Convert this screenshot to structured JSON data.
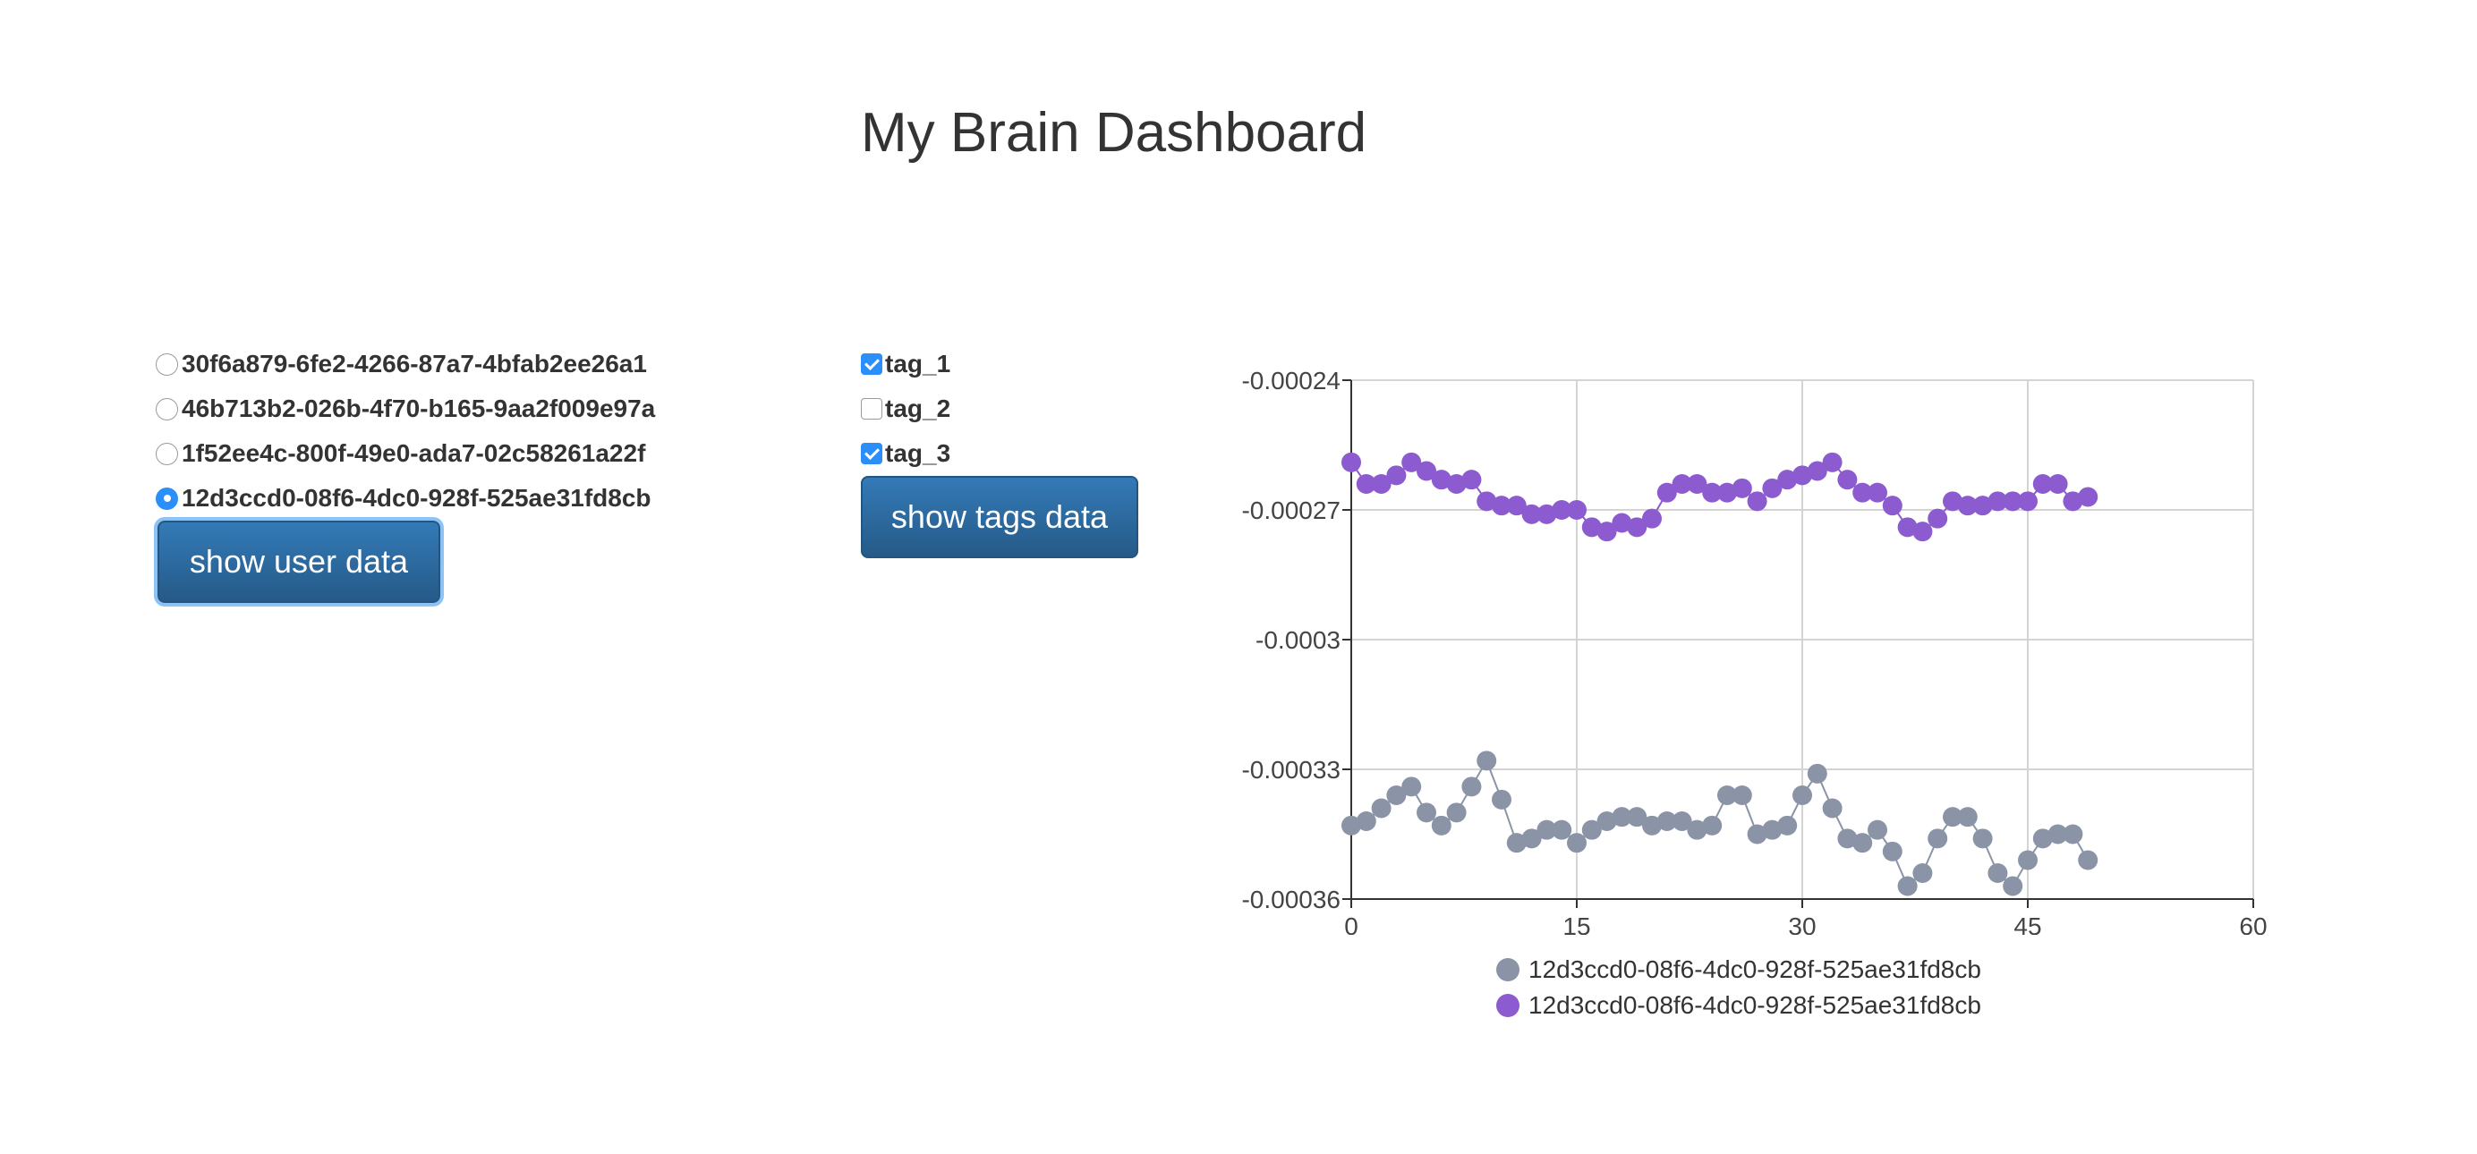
{
  "page": {
    "title": "My Brain Dashboard"
  },
  "users": {
    "options": [
      {
        "label": "30f6a879-6fe2-4266-87a7-4bfab2ee26a1",
        "checked": false
      },
      {
        "label": "46b713b2-026b-4f70-b165-9aa2f009e97a",
        "checked": false
      },
      {
        "label": "1f52ee4c-800f-49e0-ada7-02c58261a22f",
        "checked": false
      },
      {
        "label": "12d3ccd0-08f6-4dc0-928f-525ae31fd8cb",
        "checked": true
      }
    ],
    "button_label": "show user data"
  },
  "tags": {
    "options": [
      {
        "label": "tag_1",
        "checked": true
      },
      {
        "label": "tag_2",
        "checked": false
      },
      {
        "label": "tag_3",
        "checked": true
      }
    ],
    "button_label": "show tags data"
  },
  "colors": {
    "accent": "#2c8ef8",
    "button": "#2b6aa3",
    "series_gray": "#8a94a6",
    "series_purple": "#8b5bcf"
  },
  "chart_data": {
    "type": "line",
    "grid": true,
    "legend_placement": "bottom",
    "xlim": [
      0,
      60
    ],
    "ylim": [
      -0.00036,
      -0.00024
    ],
    "x_ticks": [
      0,
      15,
      30,
      45,
      60
    ],
    "x_tick_labels": [
      "0",
      "15",
      "30",
      "45",
      "60"
    ],
    "y_ticks": [
      -0.00024,
      -0.00027,
      -0.0003,
      -0.00033,
      -0.00036
    ],
    "y_tick_labels": [
      "-0.00024",
      "-0.00027",
      "-0.0003",
      "-0.00033",
      "-0.00036"
    ],
    "series": [
      {
        "name": "12d3ccd0-08f6-4dc0-928f-525ae31fd8cb",
        "color": "#8a94a6",
        "x": [
          0,
          1,
          2,
          3,
          4,
          5,
          6,
          7,
          8,
          9,
          10,
          11,
          12,
          13,
          14,
          15,
          16,
          17,
          18,
          19,
          20,
          21,
          22,
          23,
          24,
          25,
          26,
          27,
          28,
          29,
          30,
          31,
          32,
          33,
          34,
          35,
          36,
          37,
          38,
          39,
          40,
          41,
          42,
          43,
          44,
          45,
          46,
          47,
          48,
          49
        ],
        "values": [
          -0.000343,
          -0.000342,
          -0.000339,
          -0.000336,
          -0.000334,
          -0.00034,
          -0.000343,
          -0.00034,
          -0.000334,
          -0.000328,
          -0.000337,
          -0.000347,
          -0.000346,
          -0.000344,
          -0.000344,
          -0.000347,
          -0.000344,
          -0.000342,
          -0.000341,
          -0.000341,
          -0.000343,
          -0.000342,
          -0.000342,
          -0.000344,
          -0.000343,
          -0.000336,
          -0.000336,
          -0.000345,
          -0.000344,
          -0.000343,
          -0.000336,
          -0.000331,
          -0.000339,
          -0.000346,
          -0.000347,
          -0.000344,
          -0.000349,
          -0.000357,
          -0.000354,
          -0.000346,
          -0.000341,
          -0.000341,
          -0.000346,
          -0.000354,
          -0.000357,
          -0.000351,
          -0.000346,
          -0.000345,
          -0.000345,
          -0.000351
        ]
      },
      {
        "name": "12d3ccd0-08f6-4dc0-928f-525ae31fd8cb",
        "color": "#8b5bcf",
        "x": [
          0,
          1,
          2,
          3,
          4,
          5,
          6,
          7,
          8,
          9,
          10,
          11,
          12,
          13,
          14,
          15,
          16,
          17,
          18,
          19,
          20,
          21,
          22,
          23,
          24,
          25,
          26,
          27,
          28,
          29,
          30,
          31,
          32,
          33,
          34,
          35,
          36,
          37,
          38,
          39,
          40,
          41,
          42,
          43,
          44,
          45,
          46,
          47,
          48,
          49
        ],
        "values": [
          -0.000259,
          -0.000264,
          -0.000264,
          -0.000262,
          -0.000259,
          -0.000261,
          -0.000263,
          -0.000264,
          -0.000263,
          -0.000268,
          -0.000269,
          -0.000269,
          -0.000271,
          -0.000271,
          -0.00027,
          -0.00027,
          -0.000274,
          -0.000275,
          -0.000273,
          -0.000274,
          -0.000272,
          -0.000266,
          -0.000264,
          -0.000264,
          -0.000266,
          -0.000266,
          -0.000265,
          -0.000268,
          -0.000265,
          -0.000263,
          -0.000262,
          -0.000261,
          -0.000259,
          -0.000263,
          -0.000266,
          -0.000266,
          -0.000269,
          -0.000274,
          -0.000275,
          -0.000272,
          -0.000268,
          -0.000269,
          -0.000269,
          -0.000268,
          -0.000268,
          -0.000268,
          -0.000264,
          -0.000264,
          -0.000268,
          -0.000267
        ]
      }
    ]
  }
}
